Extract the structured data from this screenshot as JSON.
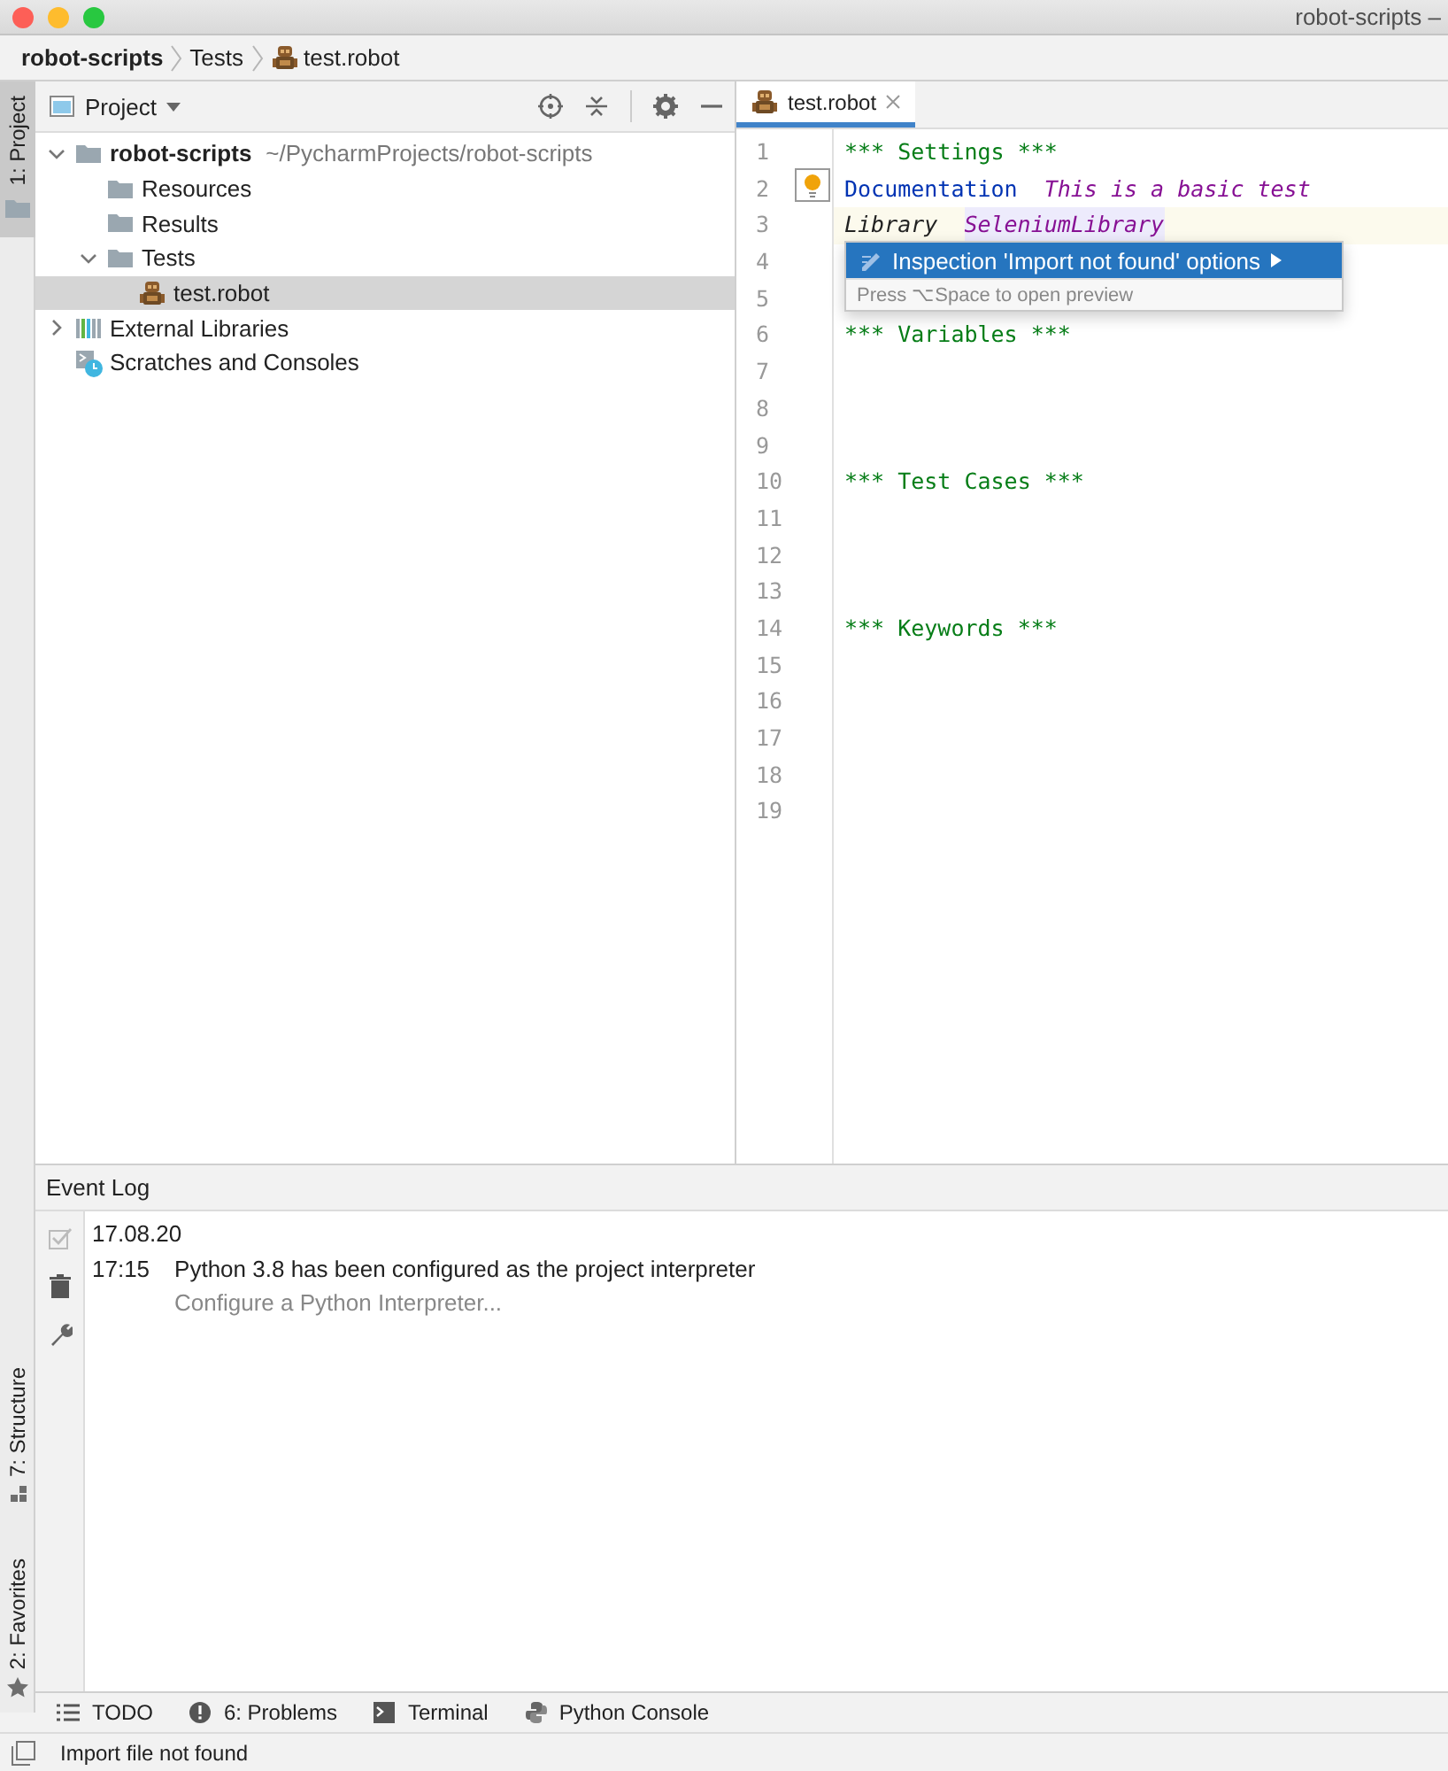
{
  "window": {
    "title": "robot-scripts –"
  },
  "breadcrumbs": [
    {
      "label": "robot-scripts",
      "kind": "project"
    },
    {
      "label": "Tests",
      "kind": "folder"
    },
    {
      "label": "test.robot",
      "kind": "robot-file"
    }
  ],
  "left_tool_tabs": [
    {
      "label": "1: Project",
      "kind": "folder",
      "selected": true
    },
    {
      "label": "7: Structure",
      "kind": "structure",
      "selected": false
    },
    {
      "label": "2: Favorites",
      "kind": "star",
      "selected": false
    }
  ],
  "project_panel": {
    "title": "Project",
    "tree": [
      {
        "label": "robot-scripts",
        "path": "~/PycharmProjects/robot-scripts",
        "kind": "folder",
        "expanded": true,
        "selected": false,
        "children": [
          {
            "label": "Resources",
            "kind": "folder",
            "selected": false
          },
          {
            "label": "Results",
            "kind": "folder",
            "selected": false
          },
          {
            "label": "Tests",
            "kind": "folder",
            "expanded": true,
            "selected": false,
            "children": [
              {
                "label": "test.robot",
                "kind": "robot-file",
                "selected": true
              }
            ]
          }
        ]
      },
      {
        "label": "External Libraries",
        "kind": "libraries",
        "expanded": false,
        "selected": false
      },
      {
        "label": "Scratches and Consoles",
        "kind": "scratches",
        "selected": false
      }
    ]
  },
  "editor": {
    "tabs": [
      {
        "label": "test.robot",
        "selected": true
      }
    ],
    "lines": [
      {
        "number": "1",
        "current": false,
        "tokens": [
          {
            "text": "*** Settings ***",
            "kind": "section"
          }
        ]
      },
      {
        "number": "2",
        "current": false,
        "tokens": [
          {
            "text": "Documentation",
            "kind": "setting"
          },
          {
            "text": "This is a basic test",
            "kind": "value"
          }
        ]
      },
      {
        "number": "3",
        "current": true,
        "tokens": [
          {
            "text": "Library",
            "kind": "keyword"
          },
          {
            "text": "SeleniumLibrary",
            "kind": "unresolved"
          }
        ]
      },
      {
        "number": "4",
        "current": false
      },
      {
        "number": "5",
        "current": false
      },
      {
        "number": "6",
        "current": false,
        "tokens": [
          {
            "text": "*** Variables ***",
            "kind": "section"
          }
        ]
      },
      {
        "number": "7",
        "current": false
      },
      {
        "number": "8",
        "current": false
      },
      {
        "number": "9",
        "current": false
      },
      {
        "number": "10",
        "current": false,
        "tokens": [
          {
            "text": "*** Test Cases ***",
            "kind": "section"
          }
        ]
      },
      {
        "number": "11",
        "current": false
      },
      {
        "number": "12",
        "current": false
      },
      {
        "number": "13",
        "current": false
      },
      {
        "number": "14",
        "current": false,
        "tokens": [
          {
            "text": "*** Keywords ***",
            "kind": "section"
          }
        ]
      },
      {
        "number": "15",
        "current": false
      },
      {
        "number": "16",
        "current": false
      },
      {
        "number": "17",
        "current": false
      },
      {
        "number": "18",
        "current": false
      },
      {
        "number": "19",
        "current": false
      }
    ],
    "popup": {
      "option": "Inspection 'Import not found' options",
      "hint": "Press ⌥Space to open preview"
    }
  },
  "event_log": {
    "title": "Event Log",
    "date": "17.08.20",
    "entries": [
      {
        "time": "17:15",
        "message": "Python 3.8 has been configured as the project interpreter",
        "link": "Configure a Python Interpreter..."
      }
    ]
  },
  "bottom_tabs": [
    {
      "label": "TODO",
      "kind": "list"
    },
    {
      "label": "6: Problems",
      "kind": "problems"
    },
    {
      "label": "Terminal",
      "kind": "terminal"
    },
    {
      "label": "Python Console",
      "kind": "python"
    }
  ],
  "status_bar": {
    "message": "Import file not found"
  }
}
